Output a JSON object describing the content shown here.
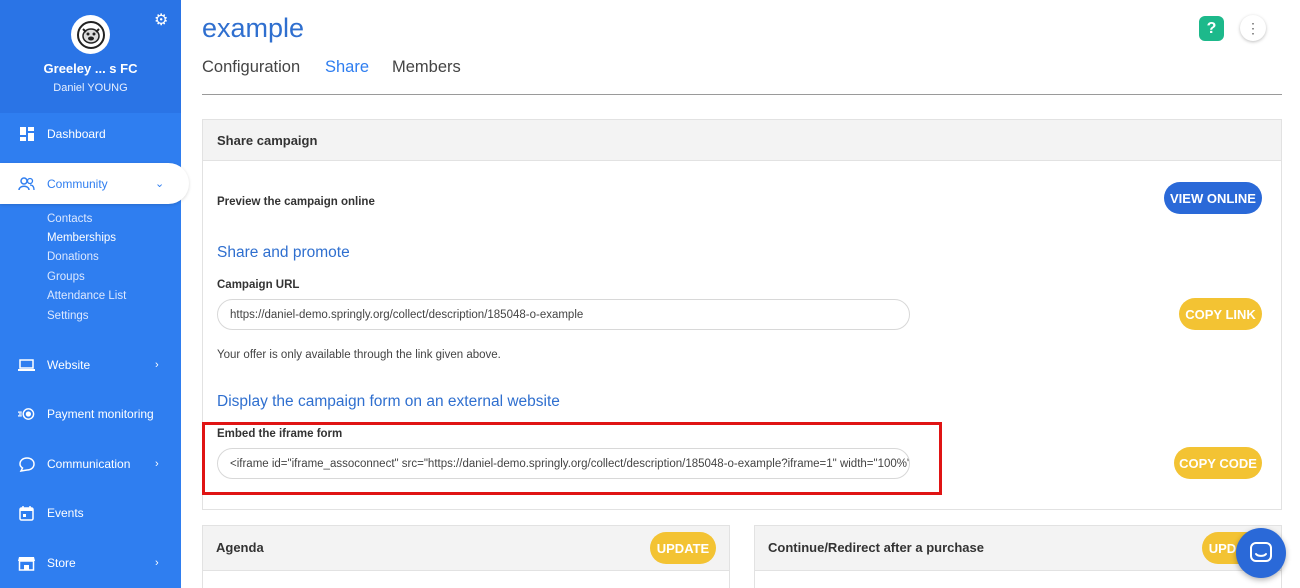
{
  "sidebar": {
    "org_name": "Greeley ... s FC",
    "user_name": "Daniel YOUNG",
    "logo_icon": "bulldog-logo-icon",
    "items": [
      {
        "label": "Dashboard",
        "icon": "dashboard-icon"
      },
      {
        "label": "Community",
        "icon": "community-icon",
        "expanded": true
      },
      {
        "label": "Website",
        "icon": "laptop-icon"
      },
      {
        "label": "Payment monitoring",
        "icon": "payment-icon"
      },
      {
        "label": "Communication",
        "icon": "chat-icon"
      },
      {
        "label": "Events",
        "icon": "calendar-icon"
      },
      {
        "label": "Store",
        "icon": "store-icon"
      }
    ],
    "community_sub": [
      "Contacts",
      "Memberships",
      "Donations",
      "Groups",
      "Attendance List",
      "Settings"
    ],
    "selected_sub": "Memberships"
  },
  "page": {
    "title": "example",
    "tabs": [
      "Configuration",
      "Share",
      "Members"
    ],
    "active_tab": "Share",
    "help_label": "?",
    "more_label": "⋮"
  },
  "share": {
    "card_title": "Share campaign",
    "preview_label": "Preview the campaign online",
    "view_online": "VIEW ONLINE",
    "promote_title": "Share and promote",
    "url_label": "Campaign URL",
    "url_value": "https://daniel-demo.springly.org/collect/description/185048-o-example",
    "copy_link": "COPY LINK",
    "url_note": "Your offer is only available through the link given above.",
    "embed_title": "Display the campaign form on an external website",
    "iframe_label": "Embed the iframe form",
    "iframe_value": "<iframe id=\"iframe_assoconnect\" src=\"https://daniel-demo.springly.org/collect/description/185048-o-example?iframe=1\" width=\"100%\"",
    "copy_code": "COPY CODE"
  },
  "agenda": {
    "title": "Agenda",
    "update": "UPDATE"
  },
  "redirect": {
    "title": "Continue/Redirect after a purchase",
    "update": "UPDATE"
  },
  "colors": {
    "sidebar": "#2f7ef0",
    "accent": "#2a69d8",
    "yellow": "#f3c333",
    "highlight": "#e01414",
    "help": "#1db98b"
  }
}
